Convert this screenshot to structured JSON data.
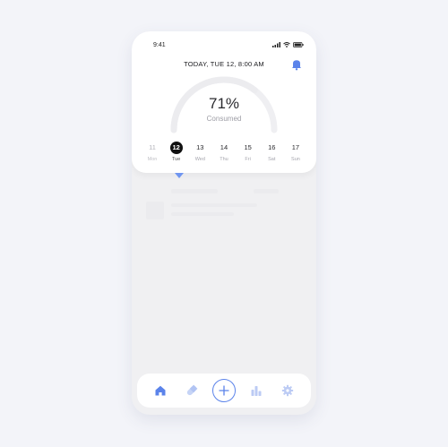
{
  "status_bar": {
    "time": "9:41"
  },
  "header": {
    "date": "TODAY, TUE 12, 8:00 AM",
    "bell_icon": "bell-icon"
  },
  "progress": {
    "value_text": "71%",
    "fraction": 0.71,
    "label": "Consumed"
  },
  "week": [
    {
      "num": "11",
      "name": "Mon",
      "state": "past"
    },
    {
      "num": "12",
      "name": "Tue",
      "state": "selected"
    },
    {
      "num": "13",
      "name": "Wed",
      "state": "future"
    },
    {
      "num": "14",
      "name": "Thu",
      "state": "future"
    },
    {
      "num": "15",
      "name": "Fri",
      "state": "future"
    },
    {
      "num": "16",
      "name": "Sat",
      "state": "future"
    },
    {
      "num": "17",
      "name": "Sun",
      "state": "future"
    }
  ],
  "tabbar": {
    "items": [
      {
        "icon": "home-icon",
        "active": true
      },
      {
        "icon": "pill-icon",
        "active": false
      },
      {
        "icon": "add-icon",
        "active": false
      },
      {
        "icon": "bar-chart-icon",
        "active": false
      },
      {
        "icon": "gear-icon",
        "active": false
      }
    ]
  },
  "colors": {
    "accent": "#5b83ea",
    "accent_light": "#b7c8f4",
    "gauge_track": "#efeff2",
    "selected_day": "#111111"
  }
}
